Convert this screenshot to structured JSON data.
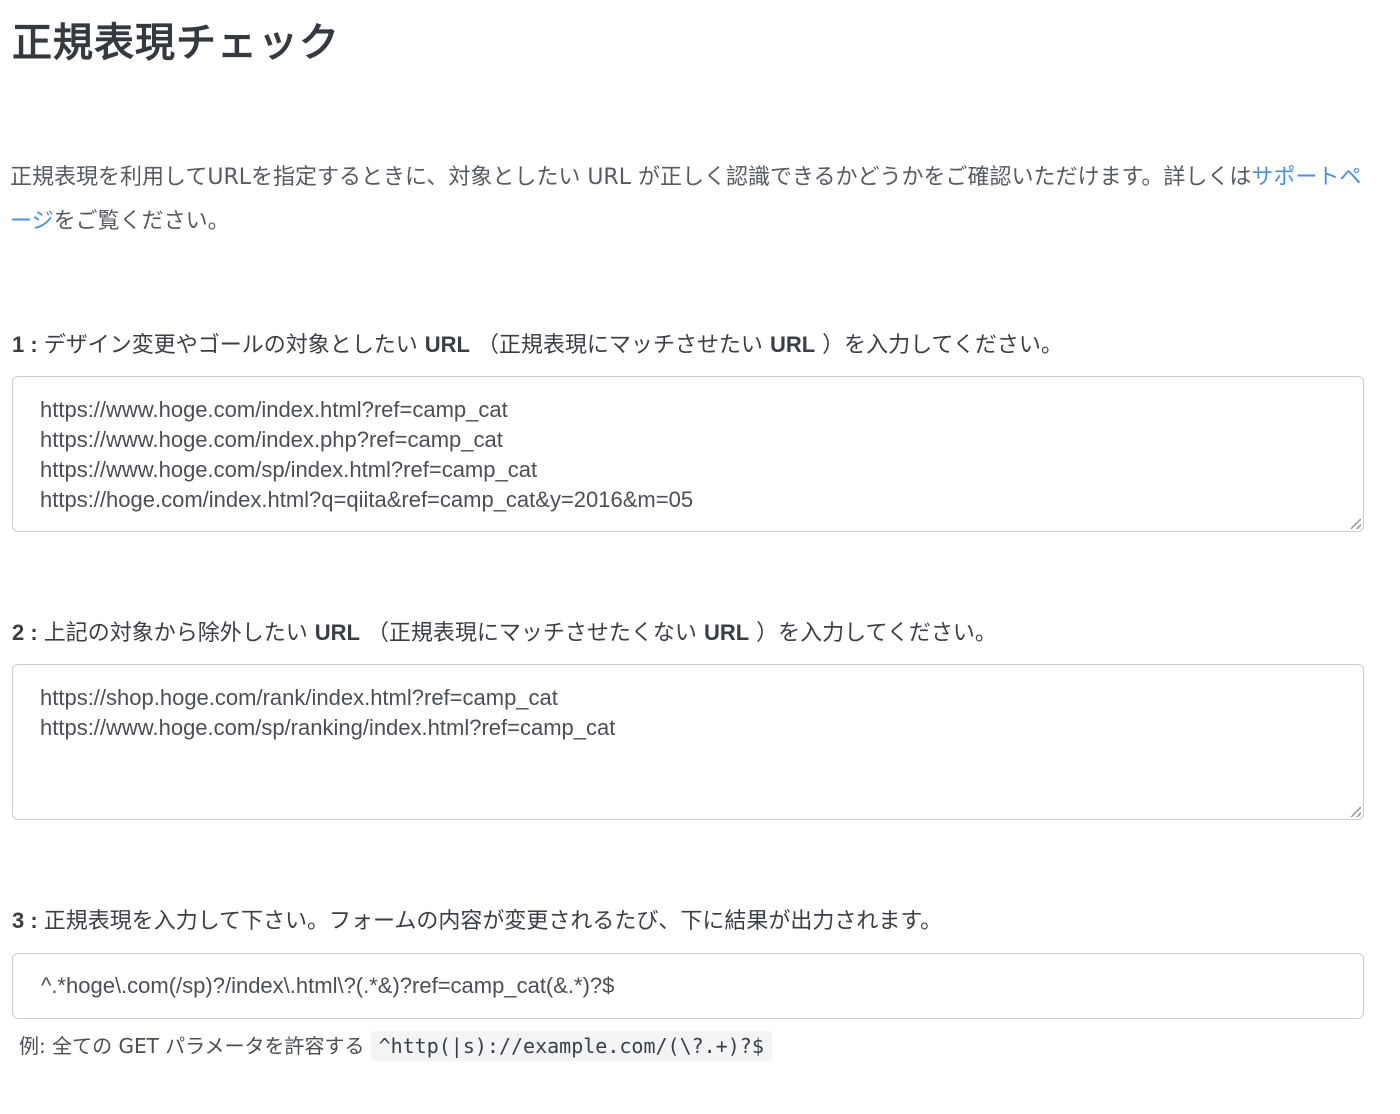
{
  "page": {
    "title": "正規表現チェック",
    "intro_text": "正規表現を利用してURLを指定するときに、対象としたい URL が正しく認識できるかどうかをご確認いただけます。詳しくは",
    "support_link": "サポートページ",
    "intro_suffix": "をご覧ください。"
  },
  "step1": {
    "number": "1 :",
    "label_a": "デザイン変更やゴールの対象としたい",
    "url1": "URL",
    "label_b": "（正規表現にマッチさせたい",
    "url2": "URL",
    "label_c": "）を入力してください。",
    "value": "https://www.hoge.com/index.html?ref=camp_cat\nhttps://www.hoge.com/index.php?ref=camp_cat\nhttps://www.hoge.com/sp/index.html?ref=camp_cat\nhttps://hoge.com/index.html?q=qiita&ref=camp_cat&y=2016&m=05"
  },
  "step2": {
    "number": "2 :",
    "label_a": "上記の対象から除外したい",
    "url1": "URL",
    "label_b": "（正規表現にマッチさせたくない",
    "url2": "URL",
    "label_c": "）を入力してください。",
    "value": "https://shop.hoge.com/rank/index.html?ref=camp_cat\nhttps://www.hoge.com/sp/ranking/index.html?ref=camp_cat"
  },
  "step3": {
    "number": "3 :",
    "label": "正規表現を入力して下さい。フォームの内容が変更されるたび、下に結果が出力されます。",
    "value": "^.*hoge\\.com(/sp)?/index\\.html\\?(.*&)?ref=camp_cat(&.*)?$"
  },
  "example": {
    "label": "例: 全ての GET パラメータを許容する",
    "code": "^http(|s)://example.com/(\\?.+)?$"
  }
}
